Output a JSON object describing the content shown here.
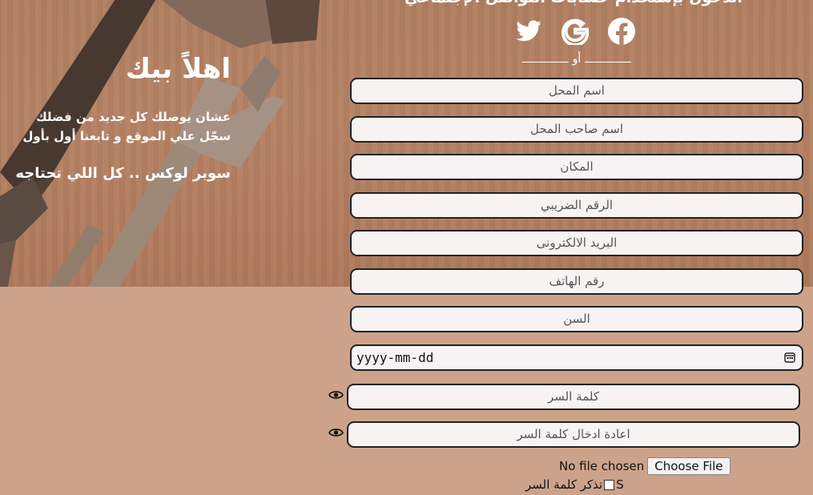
{
  "header": {
    "social_prompt": "الدخول بإستخدام حسابات التواصل الإجتماعي"
  },
  "socials": [
    {
      "icon": "twitter-icon"
    },
    {
      "icon": "google-icon"
    },
    {
      "icon": "facebook-icon"
    }
  ],
  "divider": {
    "or_label": "أو"
  },
  "welcome": {
    "title": "اهلاً بيك",
    "line1": "عشان يوصلك كل جديد من فضلك",
    "line2": "سجّل علي الموقع و تابعنا أول بأول",
    "slogan": "سوبر لوكس .. كل اللي تحتاجه"
  },
  "form": {
    "shop_name": "اسم المحل",
    "owner_name": "اسم صاحب المحل",
    "location": "المكان",
    "tax_number": "الرقم الضريبي",
    "email": "البريد الالكترونى",
    "phone": "رقم الهاتف",
    "age": "السن",
    "date_placeholder": "yyyy-mm-dd",
    "password": "كلمة السر",
    "confirm_password": "اعادة ادخال كلمة السر",
    "file_status": "No file chosen",
    "file_button": "Choose File",
    "remember_me": "تذكر كلمة السر",
    "remember_prefix": "S"
  },
  "colors": {
    "background": "#cca38a",
    "field_bg": "#f7f3f3",
    "text_white": "#ffffff"
  }
}
